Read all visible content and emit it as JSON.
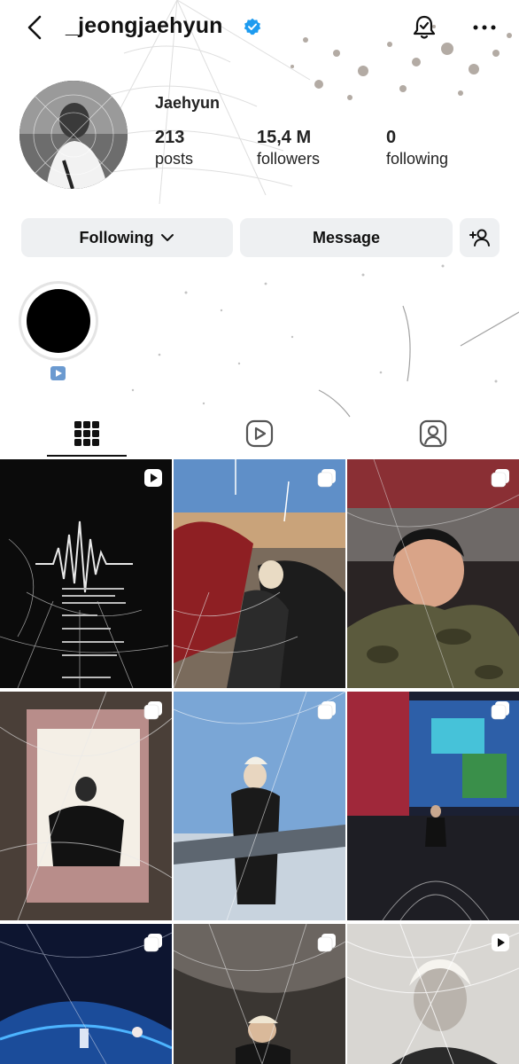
{
  "header": {
    "username": "_jeongjaehyun",
    "verified": true
  },
  "profile": {
    "display_name": "Jaehyun",
    "stats": {
      "posts_count": "213",
      "posts_label": "posts",
      "followers_count": "15,4 M",
      "followers_label": "followers",
      "following_count": "0",
      "following_label": "following"
    }
  },
  "actions": {
    "following_label": "Following",
    "message_label": "Message"
  },
  "highlights": [
    {
      "icon": "reel-icon"
    }
  ],
  "tabs": [
    {
      "icon": "grid-icon",
      "active": true
    },
    {
      "icon": "reels-icon",
      "active": false
    },
    {
      "icon": "tagged-icon",
      "active": false
    }
  ],
  "posts": [
    {
      "badge": "reel-icon"
    },
    {
      "badge": "carousel-icon"
    },
    {
      "badge": "carousel-icon"
    },
    {
      "badge": "carousel-icon"
    },
    {
      "badge": "carousel-icon"
    },
    {
      "badge": "carousel-icon"
    },
    {
      "badge": "carousel-icon"
    },
    {
      "badge": "carousel-icon"
    },
    {
      "badge": "reel-icon"
    }
  ],
  "colors": {
    "verified_blue": "#1d9bf0",
    "button_bg": "#eef0f2",
    "text": "#111111"
  }
}
